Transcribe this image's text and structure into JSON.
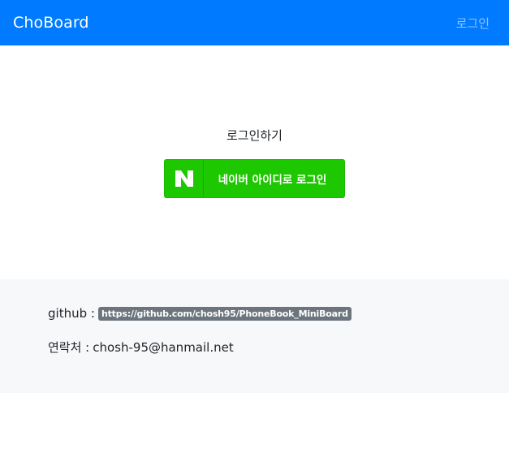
{
  "navbar": {
    "brand": "ChoBoard",
    "login_link": "로그인",
    "bg_color": "#007bff"
  },
  "main": {
    "heading": "로그인하기",
    "naver_button": {
      "logo_letter": "N",
      "label": "네이버 아이디로 로그인",
      "icon": "naver-logo-icon",
      "bg_color": "#1ec800"
    }
  },
  "footer": {
    "github_label": "github :",
    "github_url": "https://github.com/chosh95/PhoneBook_MiniBoard",
    "contact_label": "연락처 :",
    "contact_email": "chosh-95@hanmail.net",
    "badge_color": "#6c757d",
    "bg_color": "#f7f8fa"
  }
}
